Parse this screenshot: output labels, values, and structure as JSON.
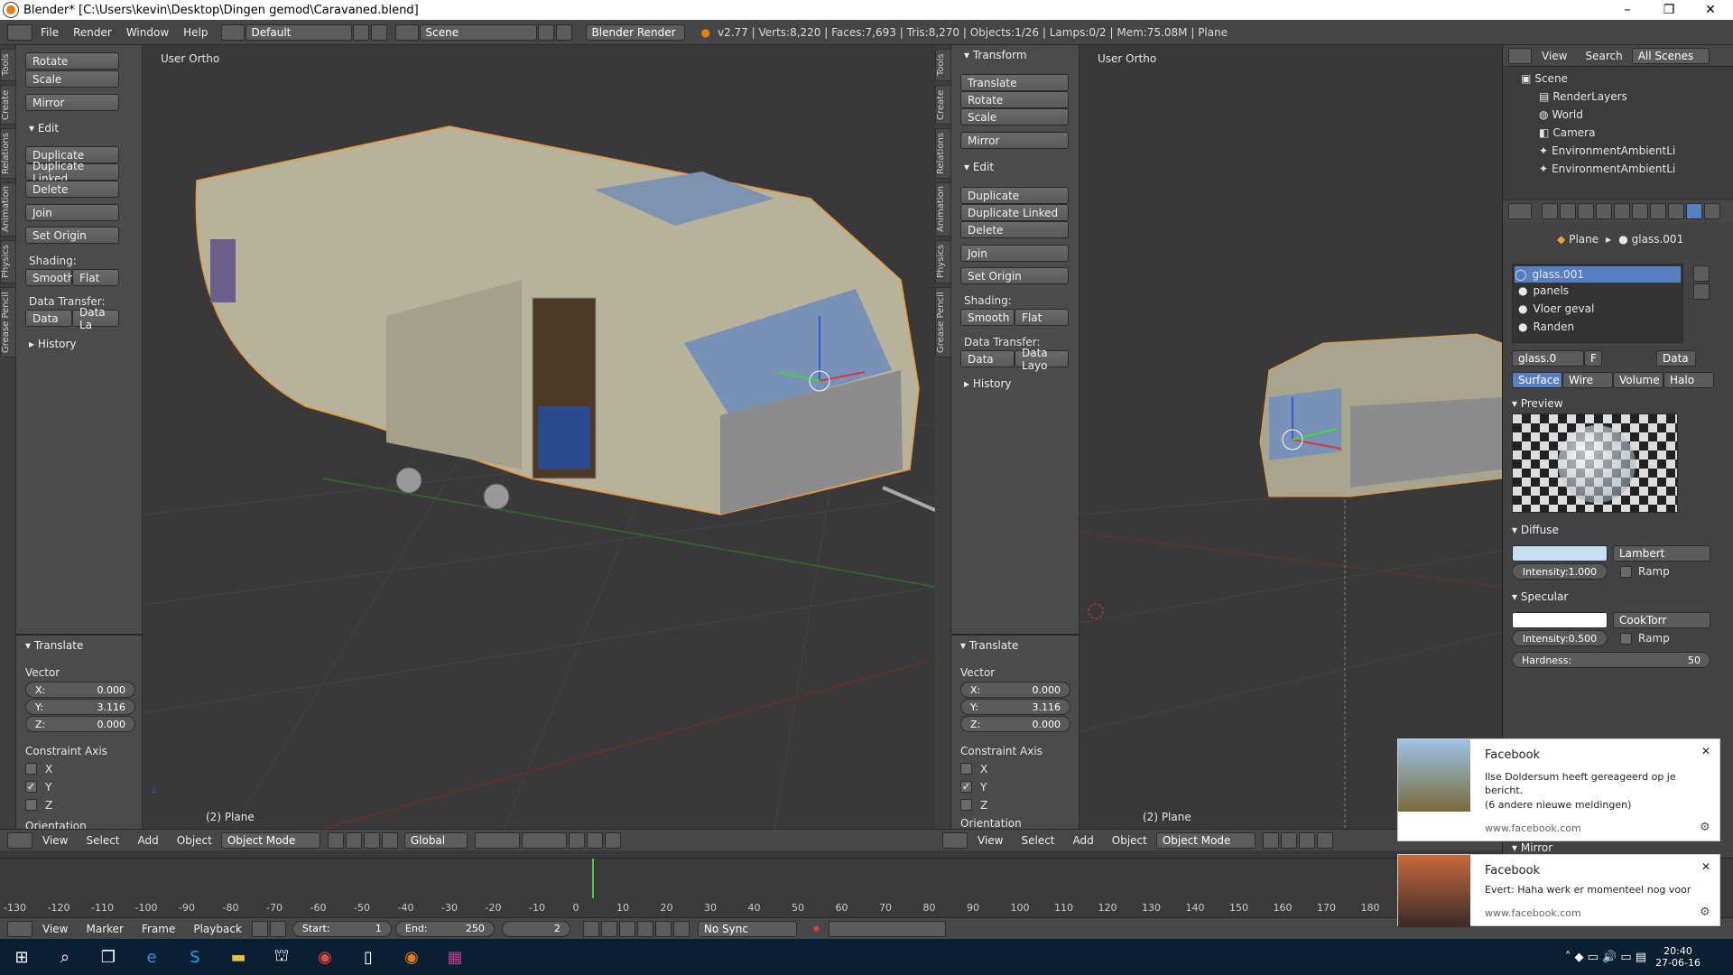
{
  "window": {
    "title": "Blender* [C:\\Users\\kevin\\Desktop\\Dingen gemod\\Caravaned.blend]",
    "minimize": "–",
    "maximize": "❐",
    "close": "✕"
  },
  "menubar": {
    "menus": [
      "File",
      "Render",
      "Window",
      "Help"
    ],
    "layout": "Default",
    "scene": "Scene",
    "engine": "Blender Render",
    "stats": "v2.77 | Verts:8,220 | Faces:7,693 | Tris:8,270 | Objects:1/26 | Lamps:0/2 | Mem:75.08M | Plane"
  },
  "left_panel": {
    "tabs": [
      "Tools",
      "Create",
      "Relations",
      "Animation",
      "Physics",
      "Grease Pencil"
    ],
    "transform_buttons": [
      "Rotate",
      "Scale"
    ],
    "mirror": "Mirror",
    "edit_header": "Edit",
    "duplicate": "Duplicate",
    "duplicate_linked": "Duplicate Linked",
    "delete": "Delete",
    "join": "Join",
    "set_origin": "Set Origin",
    "shading": "Shading:",
    "smooth": "Smooth",
    "flat": "Flat",
    "data_transfer": "Data Transfer:",
    "data": "Data",
    "data_layout": "Data La",
    "history": "History"
  },
  "left_op": {
    "header": "Translate",
    "vector": "Vector",
    "x_label": "X:",
    "x": "0.000",
    "y_label": "Y:",
    "y": "3.116",
    "z_label": "Z:",
    "z": "0.000",
    "constraint": "Constraint Axis",
    "cx": "X",
    "cy": "Y",
    "cz": "Z",
    "orientation": "Orientation"
  },
  "vp_left": {
    "view": "User Ortho",
    "object": "(2) Plane"
  },
  "mid_panel": {
    "transform_header": "Transform",
    "translate": "Translate",
    "rotate": "Rotate",
    "scale": "Scale",
    "mirror": "Mirror",
    "edit_header": "Edit",
    "duplicate": "Duplicate",
    "duplicate_linked": "Duplicate Linked",
    "delete": "Delete",
    "join": "Join",
    "set_origin": "Set Origin",
    "shading": "Shading:",
    "smooth": "Smooth",
    "flat": "Flat",
    "data_transfer": "Data Transfer:",
    "data": "Data",
    "data_layout": "Data Layo",
    "history": "History"
  },
  "mid_op": {
    "header": "Translate",
    "vector": "Vector",
    "x_label": "X:",
    "x": "0.000",
    "y_label": "Y:",
    "y": "3.116",
    "z_label": "Z:",
    "z": "0.000",
    "constraint": "Constraint Axis",
    "cx": "X",
    "cy": "Y",
    "cz": "Z",
    "orientation": "Orientation"
  },
  "vp_right": {
    "view": "User Ortho",
    "object": "(2) Plane"
  },
  "vp_header": {
    "menus": [
      "View",
      "Select",
      "Add",
      "Object"
    ],
    "mode": "Object Mode",
    "orientation": "Global"
  },
  "outliner": {
    "menus": [
      "View",
      "Search"
    ],
    "filter": "All Scenes",
    "items": [
      "Scene",
      "RenderLayers",
      "World",
      "Camera",
      "EnvironmentAmbientLi",
      "EnvironmentAmbientLi"
    ]
  },
  "properties": {
    "breadcrumb_obj": "Plane",
    "breadcrumb_mat": "glass.001",
    "materials": [
      "glass.001",
      "panels",
      "Vloer geval",
      "Randen"
    ],
    "mat_field": "glass.0",
    "f": "F",
    "data": "Data",
    "tabs": [
      "Surface",
      "Wire",
      "Volume",
      "Halo"
    ],
    "preview": "Preview",
    "diffuse": "Diffuse",
    "diffuse_shader": "Lambert",
    "intensity_label": "Intensity:",
    "diffuse_intensity": "1.000",
    "ramp": "Ramp",
    "specular": "Specular",
    "spec_shader": "CookTorr",
    "spec_intensity": "0.500",
    "hardness_label": "Hardness:",
    "hardness": "50",
    "mirror": "Mirror",
    "colors": {
      "diffuse": "#c8dff0",
      "specular": "#ffffff",
      "active": "#5680c2"
    }
  },
  "timeline": {
    "ticks": [
      "-130",
      "-120",
      "-110",
      "-100",
      "-90",
      "-80",
      "-70",
      "-60",
      "-50",
      "-40",
      "-30",
      "-20",
      "-10",
      "0",
      "10",
      "20",
      "30",
      "40",
      "50",
      "60",
      "70",
      "80",
      "90",
      "100",
      "110",
      "120",
      "130",
      "140",
      "150",
      "160",
      "170",
      "180"
    ],
    "menus": [
      "View",
      "Marker",
      "Frame",
      "Playback"
    ],
    "start_label": "Start:",
    "start": "1",
    "end_label": "End:",
    "end": "250",
    "current": "2",
    "sync": "No Sync"
  },
  "notifications": [
    {
      "app": "Facebook",
      "text": "Ilse Doldersum heeft gereageerd op je bericht.",
      "sub": "(6 andere nieuwe meldingen)",
      "source": "www.facebook.com"
    },
    {
      "app": "Facebook",
      "text": "Evert: Haha werk er momenteel nog voor",
      "source": "www.facebook.com"
    }
  ],
  "taskbar": {
    "time": "20:40",
    "date": "27-06-16"
  }
}
